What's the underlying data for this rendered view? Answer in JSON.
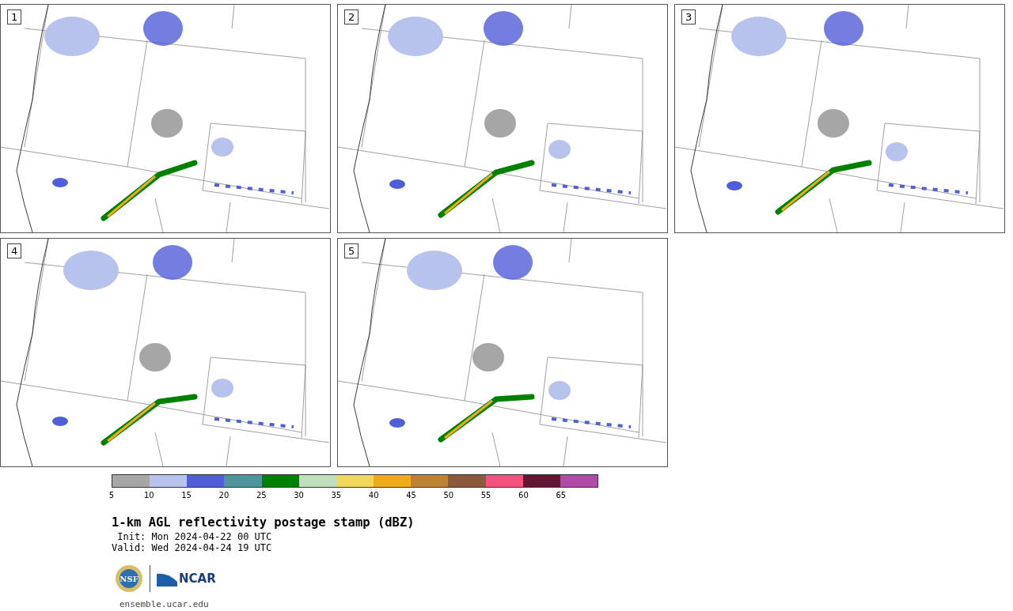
{
  "panels": [
    {
      "label": "1"
    },
    {
      "label": "2"
    },
    {
      "label": "3"
    },
    {
      "label": "4"
    },
    {
      "label": "5"
    }
  ],
  "colorbar": {
    "segments": [
      {
        "color": "#a6a6a6",
        "tick": "5"
      },
      {
        "color": "#b7c2ed",
        "tick": "10"
      },
      {
        "color": "#505ed8",
        "tick": "15"
      },
      {
        "color": "#4f969c",
        "tick": "20"
      },
      {
        "color": "#008000",
        "tick": "25"
      },
      {
        "color": "#c0dfbf",
        "tick": "30"
      },
      {
        "color": "#f0d85c",
        "tick": "35"
      },
      {
        "color": "#eeac1a",
        "tick": "40"
      },
      {
        "color": "#bd8234",
        "tick": "45"
      },
      {
        "color": "#8b5a3c",
        "tick": "50"
      },
      {
        "color": "#f3527e",
        "tick": "55"
      },
      {
        "color": "#631734",
        "tick": "60"
      },
      {
        "color": "#af4ca5",
        "tick": "65"
      }
    ]
  },
  "title": "1-km AGL reflectivity postage stamp (dBZ)",
  "init": " Init: Mon 2024-04-22 00 UTC",
  "valid": "Valid: Wed 2024-04-24 19 UTC",
  "logos": {
    "nsf": "NSF",
    "ncar": "NCAR"
  },
  "footer": "ensemble.ucar.edu"
}
